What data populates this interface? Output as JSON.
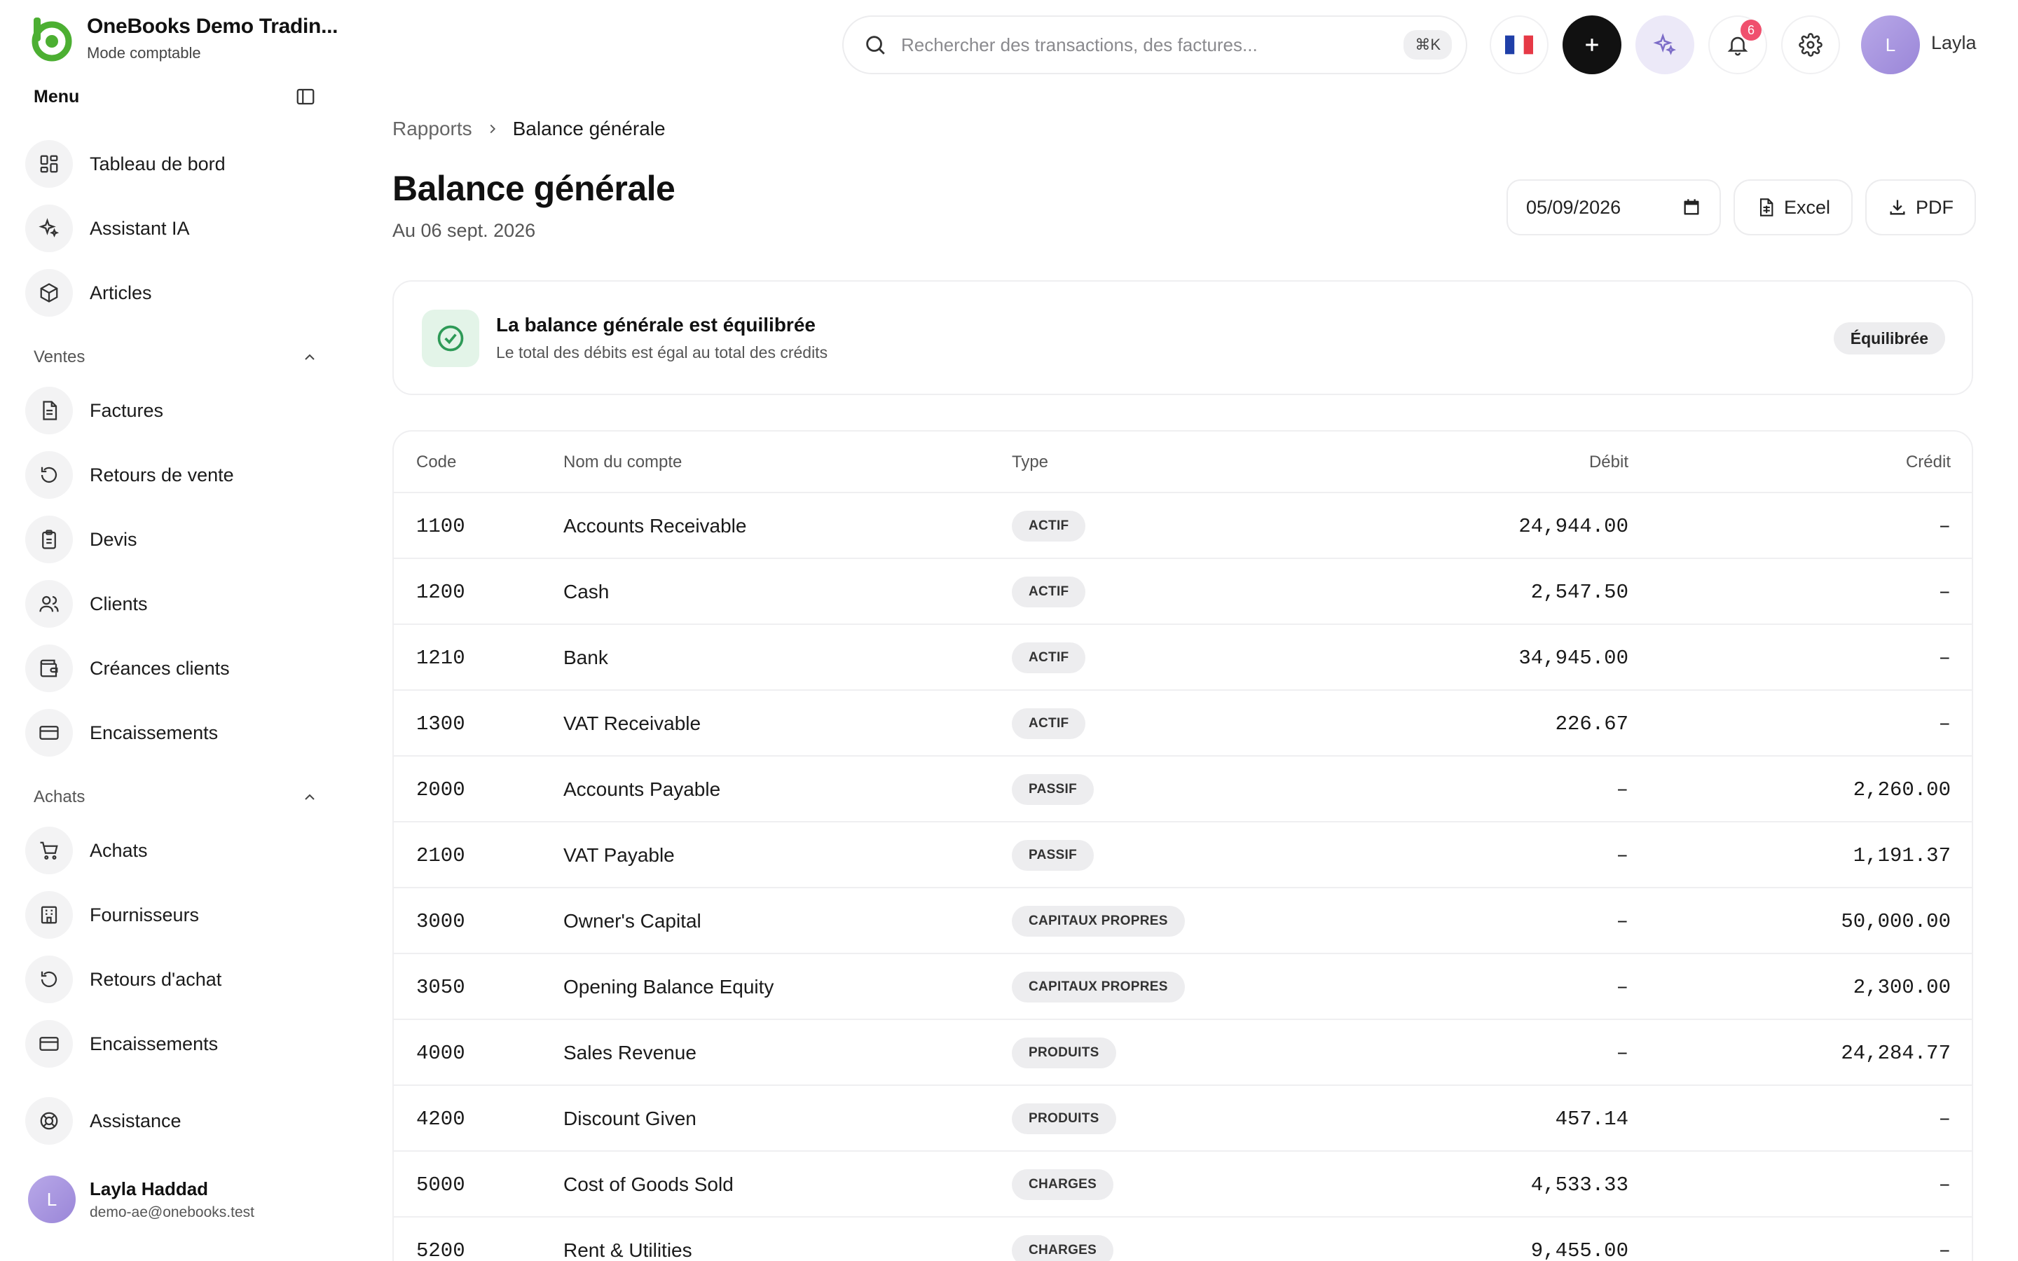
{
  "brand": {
    "name": "OneBooks Demo Tradin...",
    "mode": "Mode comptable",
    "accent": "#4caf32"
  },
  "sidebar": {
    "menu_title": "Menu",
    "items_top": [
      {
        "label": "Tableau de bord",
        "icon": "dashboard-icon"
      },
      {
        "label": "Assistant IA",
        "icon": "sparkles-icon"
      },
      {
        "label": "Articles",
        "icon": "box-icon"
      }
    ],
    "sales": {
      "label": "Ventes",
      "items": [
        {
          "label": "Factures",
          "icon": "invoice-icon"
        },
        {
          "label": "Retours de vente",
          "icon": "return-icon"
        },
        {
          "label": "Devis",
          "icon": "clipboard-icon"
        },
        {
          "label": "Clients",
          "icon": "users-icon"
        },
        {
          "label": "Créances clients",
          "icon": "wallet-icon"
        },
        {
          "label": "Encaissements",
          "icon": "card-icon"
        }
      ]
    },
    "purchases": {
      "label": "Achats",
      "items": [
        {
          "label": "Achats",
          "icon": "cart-icon"
        },
        {
          "label": "Fournisseurs",
          "icon": "building-icon"
        },
        {
          "label": "Retours d'achat",
          "icon": "return-icon"
        },
        {
          "label": "Encaissements",
          "icon": "card-icon"
        }
      ]
    },
    "support": {
      "label": "Assistance",
      "icon": "lifebuoy-icon"
    },
    "user": {
      "initial": "L",
      "name": "Layla Haddad",
      "email": "demo-ae@onebooks.test"
    }
  },
  "topbar": {
    "search_placeholder": "Rechercher des transactions, des factures...",
    "search_shortcut": "⌘K",
    "notification_count": "6",
    "user_initial": "L",
    "user_name": "Layla"
  },
  "breadcrumb": {
    "parent": "Rapports",
    "current": "Balance générale"
  },
  "page": {
    "title": "Balance générale",
    "subtitle": "Au 06 sept. 2026",
    "date_value": "05/09/2026",
    "excel_label": "Excel",
    "pdf_label": "PDF"
  },
  "status": {
    "title": "La balance générale est équilibrée",
    "description": "Le total des débits est égal au total des crédits",
    "badge": "Équilibrée",
    "color": "#2e9a57"
  },
  "table": {
    "headers": {
      "code": "Code",
      "name": "Nom du compte",
      "type": "Type",
      "debit": "Débit",
      "credit": "Crédit"
    },
    "rows": [
      {
        "code": "1100",
        "name": "Accounts Receivable",
        "type": "ACTIF",
        "debit": "24,944.00",
        "credit": "–"
      },
      {
        "code": "1200",
        "name": "Cash",
        "type": "ACTIF",
        "debit": "2,547.50",
        "credit": "–"
      },
      {
        "code": "1210",
        "name": "Bank",
        "type": "ACTIF",
        "debit": "34,945.00",
        "credit": "–"
      },
      {
        "code": "1300",
        "name": "VAT Receivable",
        "type": "ACTIF",
        "debit": "226.67",
        "credit": "–"
      },
      {
        "code": "2000",
        "name": "Accounts Payable",
        "type": "PASSIF",
        "debit": "–",
        "credit": "2,260.00"
      },
      {
        "code": "2100",
        "name": "VAT Payable",
        "type": "PASSIF",
        "debit": "–",
        "credit": "1,191.37"
      },
      {
        "code": "3000",
        "name": "Owner's Capital",
        "type": "CAPITAUX PROPRES",
        "debit": "–",
        "credit": "50,000.00"
      },
      {
        "code": "3050",
        "name": "Opening Balance Equity",
        "type": "CAPITAUX PROPRES",
        "debit": "–",
        "credit": "2,300.00"
      },
      {
        "code": "4000",
        "name": "Sales Revenue",
        "type": "PRODUITS",
        "debit": "–",
        "credit": "24,284.77"
      },
      {
        "code": "4200",
        "name": "Discount Given",
        "type": "PRODUITS",
        "debit": "457.14",
        "credit": "–"
      },
      {
        "code": "5000",
        "name": "Cost of Goods Sold",
        "type": "CHARGES",
        "debit": "4,533.33",
        "credit": "–"
      },
      {
        "code": "5200",
        "name": "Rent & Utilities",
        "type": "CHARGES",
        "debit": "9,455.00",
        "credit": "–"
      }
    ]
  }
}
